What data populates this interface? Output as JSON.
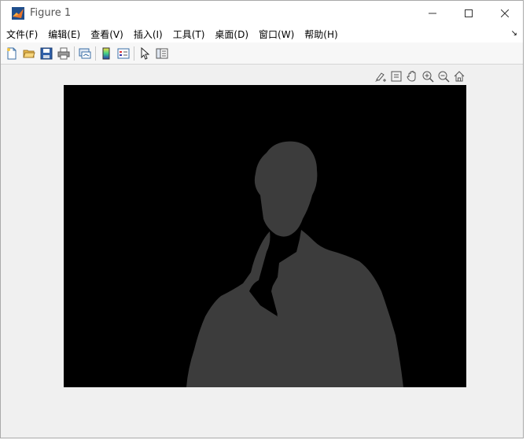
{
  "window": {
    "title": "Figure 1",
    "controls": [
      "minimize",
      "maximize",
      "close"
    ]
  },
  "menu": {
    "items": [
      {
        "label": "文件(F)"
      },
      {
        "label": "编辑(E)"
      },
      {
        "label": "查看(V)"
      },
      {
        "label": "插入(I)"
      },
      {
        "label": "工具(T)"
      },
      {
        "label": "桌面(D)"
      },
      {
        "label": "窗口(W)"
      },
      {
        "label": "帮助(H)"
      }
    ],
    "overflow_glyph": "↘"
  },
  "toolbar": {
    "buttons": [
      "new-figure-icon",
      "open-file-icon",
      "save-icon",
      "print-icon",
      "link-plot-icon",
      "insert-colorbar-icon",
      "insert-legend-icon",
      "edit-plot-icon",
      "property-inspector-icon"
    ]
  },
  "axes_toolbar": {
    "buttons": [
      "brush-icon",
      "datatip-icon",
      "pan-icon",
      "zoom-in-icon",
      "zoom-out-icon",
      "restore-view-icon"
    ]
  },
  "image": {
    "description_color_background": "#000000",
    "foreground_color": "#3c3c3c"
  }
}
